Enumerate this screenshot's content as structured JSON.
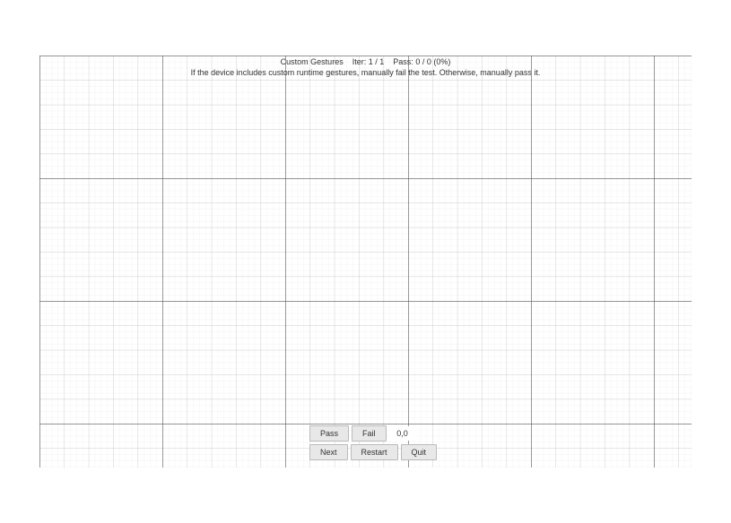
{
  "header": {
    "title_part1": "Custom Gestures",
    "iter_label": "Iter:",
    "iter_value": "1 / 1",
    "pass_label": "Pass:",
    "pass_value": "0 / 0 (0%)",
    "instruction": "If the device includes custom runtime gestures, manually fail the test. Otherwise, manually pass it."
  },
  "controls": {
    "pass_label": "Pass",
    "fail_label": "Fail",
    "value_display": "0,0",
    "next_label": "Next",
    "restart_label": "Restart",
    "quit_label": "Quit"
  },
  "grid": {
    "fine": 6.85,
    "medium": 27.4,
    "major": 137
  }
}
